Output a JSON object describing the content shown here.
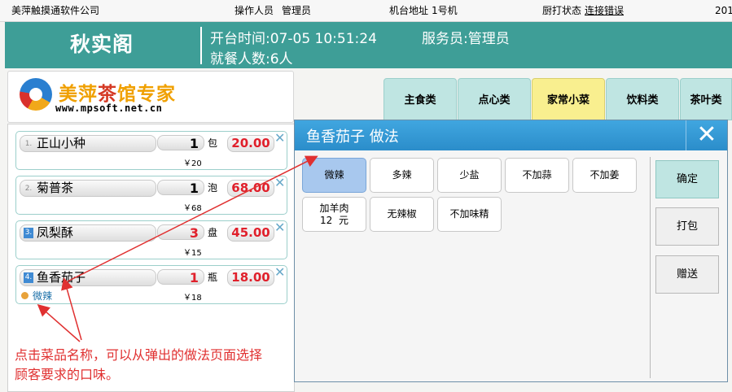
{
  "status_bar": {
    "company": "美萍触摸通软件公司",
    "operator_label": "操作人员",
    "operator_value": "管理员",
    "terminal_label": "机台地址",
    "terminal_value": "1号机",
    "printer_label": "厨打状态",
    "printer_status": "连接错误",
    "year_partial": "201"
  },
  "header": {
    "store_name": "秋实阁",
    "open_time_label": "开台时间:",
    "open_time_value": "07-05 10:51:24",
    "waiter_label": "服务员:",
    "waiter_value": "管理员",
    "guests_label": "就餐人数:",
    "guests_value": "6人"
  },
  "logo": {
    "title_left": "美萍",
    "title_mid": "茶",
    "title_right": "馆专家",
    "url": "www.mpsoft.net.cn"
  },
  "category_tabs": [
    {
      "label": "主食类",
      "active": false
    },
    {
      "label": "点心类",
      "active": false
    },
    {
      "label": "家常小菜",
      "active": true
    },
    {
      "label": "饮料类",
      "active": false
    },
    {
      "label": "茶叶类",
      "active": false
    }
  ],
  "order_items": [
    {
      "index": "1.",
      "name": "正山小种",
      "qty": "1",
      "unit": "包",
      "price": "20.00",
      "unit_price": "￥20",
      "note": ""
    },
    {
      "index": "2.",
      "name": "菊普茶",
      "qty": "1",
      "unit": "泡",
      "price": "68.00",
      "unit_price": "￥68",
      "note": ""
    },
    {
      "index": "3.",
      "name": "凤梨酥",
      "qty": "3",
      "unit": "盘",
      "price": "45.00",
      "unit_price": "￥15",
      "note": ""
    },
    {
      "index": "4.",
      "name": "鱼香茄子",
      "qty": "1",
      "unit": "瓶",
      "price": "18.00",
      "unit_price": "￥18",
      "note": "微辣"
    }
  ],
  "close_glyph": "✕",
  "annotation": {
    "line1": "点击菜品名称，可以从弹出的做法页面选择",
    "line2": "顾客要求的口味。"
  },
  "modal": {
    "title": "鱼香茄子 做法",
    "options": [
      {
        "label": "微辣",
        "selected": true
      },
      {
        "label": "多辣",
        "selected": false
      },
      {
        "label": "少盐",
        "selected": false
      },
      {
        "label": "不加蒜",
        "selected": false
      },
      {
        "label": "不加姜",
        "selected": false
      },
      {
        "label": "加羊肉",
        "sublabel": "12  元",
        "selected": false
      },
      {
        "label": "无辣椒",
        "selected": false
      },
      {
        "label": "不加味精",
        "selected": false
      }
    ],
    "side_buttons": {
      "confirm": "确定",
      "pack": "打包",
      "gift": "赠送"
    }
  },
  "colors": {
    "header_bg": "#3e9e97",
    "tab_bg": "#bfe5e2",
    "tab_active_bg": "#f9ef8f",
    "price_red": "#e0202b",
    "modal_header": "#2b8dca",
    "annotation_red": "#e03030"
  }
}
